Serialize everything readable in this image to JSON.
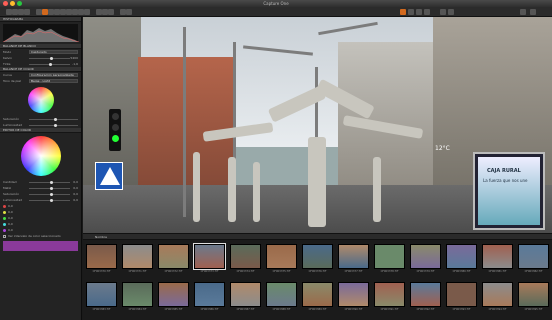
{
  "window": {
    "title": "Capture One"
  },
  "toolbar": {
    "items": [
      "import-icon",
      "capture-icon",
      "folder-icon",
      "tools-icon",
      "pointer-icon",
      "crop-icon",
      "rotate-icon",
      "keystone-icon",
      "mask-icon",
      "eraser-icon",
      "picker-icon",
      "clone-icon",
      "annotate-icon",
      "undo-icon",
      "redo-icon",
      "reset-icon",
      "copy-icon",
      "apply-icon",
      "view-icon",
      "grid-icon",
      "compare-icon",
      "proof-icon",
      "exposure-icon",
      "focus-icon",
      "export-icon",
      "process-icon"
    ]
  },
  "tools": {
    "histogram_title": "HISTOGRAMA",
    "white_balance_title": "BALANCE DE BLANCO",
    "white_balance_mode_label": "Modo",
    "white_balance_mode_value": "Capturado",
    "kelvin_label": "Kelvin",
    "kelvin_value": "5400",
    "tint_label": "Tinte",
    "tint_value": "-1,6",
    "base_title": "BALANCE DE COLOR",
    "curve_label": "Curva",
    "curve_value": "Configuración personalizada",
    "base_label": "Tono de piel",
    "base_value": "Beige - Light",
    "editor_title": "EDITOR DE COLOR",
    "saturation_label": "Saturación",
    "lightness_label": "Luminosidad",
    "smooth_label": "Suavidad",
    "uniformity_label": "Uniformidad",
    "wheel_labels": [
      "Matiz",
      "Saturación"
    ],
    "slider_labels": [
      "Cantidad",
      "Matiz",
      "Saturación",
      "Luminosidad"
    ],
    "slider_values": [
      "0,0",
      "0,0",
      "0,0",
      "0,0"
    ],
    "swatch_values": [
      "0,0",
      "0,0",
      "0,0",
      "0,0",
      "0,0"
    ],
    "view_label": "Ver intervalo de color seleccionado"
  },
  "viewer": {
    "overlay_temp": "12°C",
    "sign_logo": "CAJA RURAL",
    "sign_tagline": "La fuerza que nos une"
  },
  "browser": {
    "label": "Nombre"
  },
  "thumbnails": {
    "row1": [
      "CF003370.TIF",
      "CF003371.TIF",
      "CF003372.TIF",
      "CF003373.TIF",
      "CF003374.TIF",
      "CF003375.TIF",
      "CF003376.TIF",
      "CF003377.TIF",
      "CF003378.TIF",
      "CF003379.TIF",
      "CF003380.TIF",
      "CF003381.TIF",
      "CF003382.TIF"
    ],
    "row2": [
      "CF003383.TIF",
      "CF003384.TIF",
      "CF003385.TIF",
      "CF003386.TIF",
      "CF003387.TIF",
      "CF003388.TIF",
      "CF003389.TIF",
      "CF003390.TIF",
      "CF003391.TIF",
      "CF003392.TIF",
      "CF003393.TIF",
      "CF003394.TIF",
      "CF003395.TIF"
    ]
  },
  "colors": {
    "accent": "#d2691e",
    "panel": "#232323",
    "swatch_purple": "#8a3a9a"
  }
}
